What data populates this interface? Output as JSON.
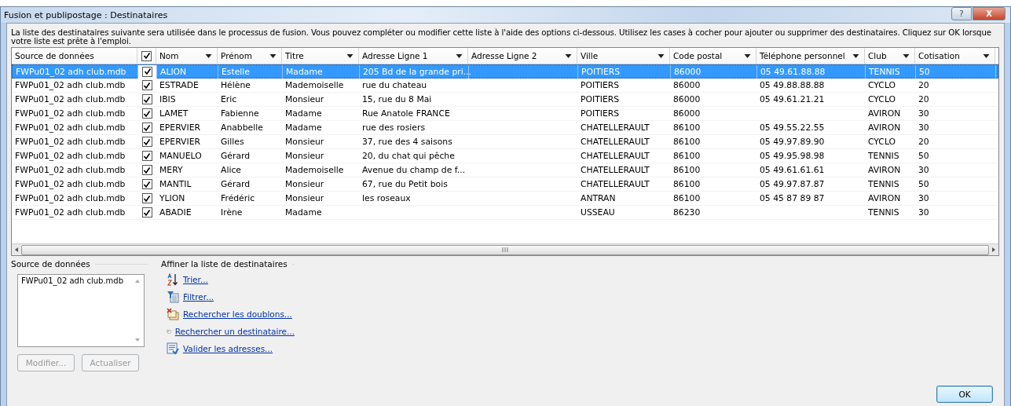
{
  "window": {
    "title": "Fusion et publipostage : Destinataires",
    "buttons": [
      {
        "kind": "help",
        "label": "?"
      },
      {
        "kind": "close",
        "label": "X"
      }
    ]
  },
  "instructions": "La liste des destinataires suivante sera utilisée dans le processus de fusion. Vous pouvez compléter ou modifier cette liste à l'aide des options ci-dessous. Utilisez les cases à cocher pour ajouter ou supprimer des destinataires. Cliquez sur OK lorsque votre liste est prête à l'emploi.",
  "table": {
    "columns": [
      {
        "label": "Source de données",
        "dropdown": false
      },
      {
        "kind": "check",
        "checked": true
      },
      {
        "label": "Nom",
        "dropdown": true
      },
      {
        "label": "Prénom",
        "dropdown": true
      },
      {
        "label": "Titre",
        "dropdown": true
      },
      {
        "label": "Adresse Ligne 1",
        "dropdown": true
      },
      {
        "label": "Adresse Ligne 2",
        "dropdown": true
      },
      {
        "label": "Ville",
        "dropdown": true
      },
      {
        "label": "Code postal",
        "dropdown": true
      },
      {
        "label": "Téléphone personnel",
        "dropdown": true
      },
      {
        "label": "Club",
        "dropdown": true
      },
      {
        "label": "Cotisation",
        "dropdown": true
      }
    ],
    "rows": [
      {
        "selected": true,
        "checked": true,
        "cells": [
          "FWPu01_02 adh club.mdb",
          "",
          "ALION",
          "Estelle",
          "Madame",
          "205 Bd de la grande pri...",
          "",
          "POITIERS",
          "86000",
          "05 49.61.88.88",
          "TENNIS",
          "50"
        ]
      },
      {
        "selected": false,
        "checked": true,
        "cells": [
          "FWPu01_02 adh club.mdb",
          "",
          "ESTRADE",
          "Hélène",
          "Mademoiselle",
          "rue du chateau",
          "",
          "POITIERS",
          "86000",
          "05 49.88.88.88",
          "CYCLO",
          "20"
        ]
      },
      {
        "selected": false,
        "checked": true,
        "cells": [
          "FWPu01_02 adh club.mdb",
          "",
          "IBIS",
          "Eric",
          "Monsieur",
          "15, rue du 8 Mai",
          "",
          "POITIERS",
          "86000",
          "05 49.61.21.21",
          "CYCLO",
          "20"
        ]
      },
      {
        "selected": false,
        "checked": true,
        "cells": [
          "FWPu01_02 adh club.mdb",
          "",
          "LAMET",
          "Fabienne",
          "Madame",
          "Rue Anatole FRANCE",
          "",
          "POITIERS",
          "86000",
          "",
          "AVIRON",
          "30"
        ]
      },
      {
        "selected": false,
        "checked": true,
        "cells": [
          "FWPu01_02 adh club.mdb",
          "",
          "EPERVIER",
          "Anabbelle",
          "Madame",
          "rue des rosiers",
          "",
          "CHATELLERAULT",
          "86100",
          "05 49.55.22.55",
          "AVIRON",
          "30"
        ]
      },
      {
        "selected": false,
        "checked": true,
        "cells": [
          "FWPu01_02 adh club.mdb",
          "",
          "EPERVIER",
          "Gilles",
          "Monsieur",
          "37, rue des 4 saisons",
          "",
          "CHATELLERAULT",
          "86100",
          "05 49.97.89.90",
          "CYCLO",
          "20"
        ]
      },
      {
        "selected": false,
        "checked": true,
        "cells": [
          "FWPu01_02 adh club.mdb",
          "",
          "MANUELO",
          "Gérard",
          "Monsieur",
          "20, du chat qui pêche",
          "",
          "CHATELLERAULT",
          "86100",
          "05 49.95.98.98",
          "TENNIS",
          "50"
        ]
      },
      {
        "selected": false,
        "checked": true,
        "cells": [
          "FWPu01_02 adh club.mdb",
          "",
          "MERY",
          "Alice",
          "Mademoiselle",
          "Avenue du champ de f...",
          "",
          "CHATELLERAULT",
          "86100",
          "05 49.61.61.61",
          "AVIRON",
          "30"
        ]
      },
      {
        "selected": false,
        "checked": true,
        "cells": [
          "FWPu01_02 adh club.mdb",
          "",
          "MANTIL",
          "Gérard",
          "Monsieur",
          "67, rue du Petit bois",
          "",
          "CHATELLERAULT",
          "86100",
          "05 49.97.87.87",
          "TENNIS",
          "50"
        ]
      },
      {
        "selected": false,
        "checked": true,
        "cells": [
          "FWPu01_02 adh club.mdb",
          "",
          "YLION",
          "Frédéric",
          "Monsieur",
          "les roseaux",
          "",
          "ANTRAN",
          "86100",
          "05 45 87 89 87",
          "AVIRON",
          "30"
        ]
      },
      {
        "selected": false,
        "checked": true,
        "cells": [
          "FWPu01_02 adh club.mdb",
          "",
          "ABADIE",
          "Irène",
          "Madame",
          "",
          "",
          "USSEAU",
          "86230",
          "",
          "TENNIS",
          "30"
        ]
      }
    ]
  },
  "data_source": {
    "heading": "Source de données",
    "items": [
      "FWPu01_02 adh club.mdb"
    ],
    "buttons": [
      {
        "label": "Modifier...",
        "disabled": true
      },
      {
        "label": "Actualiser",
        "disabled": true
      }
    ]
  },
  "refine": {
    "heading": "Affiner la liste de destinataires",
    "links": [
      {
        "kind": "sort",
        "label": "Trier..."
      },
      {
        "kind": "filter",
        "label": "Filtrer..."
      },
      {
        "kind": "duplicates",
        "label": "Rechercher les doublons..."
      },
      {
        "kind": "find",
        "label": "Rechercher un destinataire..."
      },
      {
        "kind": "validate",
        "label": "Valider les adresses..."
      }
    ]
  },
  "ok_button": "OK"
}
